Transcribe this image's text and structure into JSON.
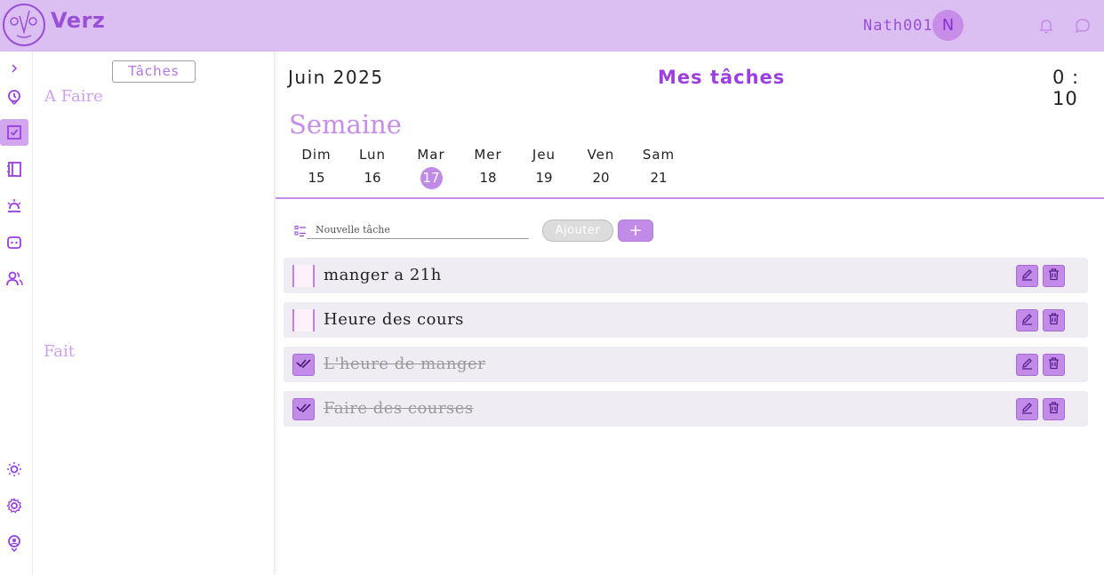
{
  "app": {
    "name": "Verz"
  },
  "user": {
    "name": "Nath001",
    "initial": "N"
  },
  "panel": {
    "tab_label": "Tâches",
    "todo_label": "A Faire",
    "done_label": "Fait"
  },
  "main": {
    "month": "Juin 2025",
    "title": "Mes tâches",
    "clock": "0 : 10",
    "week_title": "Semaine",
    "days": [
      {
        "name": "Dim",
        "num": "15",
        "today": false
      },
      {
        "name": "Lun",
        "num": "16",
        "today": false
      },
      {
        "name": "Mar",
        "num": "17",
        "today": true
      },
      {
        "name": "Mer",
        "num": "18",
        "today": false
      },
      {
        "name": "Jeu",
        "num": "19",
        "today": false
      },
      {
        "name": "Ven",
        "num": "20",
        "today": false
      },
      {
        "name": "Sam",
        "num": "21",
        "today": false
      }
    ],
    "new_task_placeholder": "Nouvelle tâche",
    "add_label": "Ajouter",
    "plus_label": "+",
    "tasks": [
      {
        "text": "manger a 21h",
        "done": false
      },
      {
        "text": "Heure des cours",
        "done": false
      },
      {
        "text": "L'heure de manger",
        "done": true
      },
      {
        "text": "Faire des courses",
        "done": true
      }
    ]
  },
  "colors": {
    "accent": "#c38be8",
    "topbar": "#dcbff2",
    "title": "#9b3fe0"
  },
  "icons": {
    "rail": [
      "chevron-right-icon",
      "clock-icon",
      "tasks-icon",
      "notebook-icon",
      "sunrise-icon",
      "bot-icon",
      "users-icon",
      "sun-icon",
      "gear-icon",
      "location-icon"
    ],
    "top": [
      "bell-icon",
      "chat-icon"
    ]
  }
}
